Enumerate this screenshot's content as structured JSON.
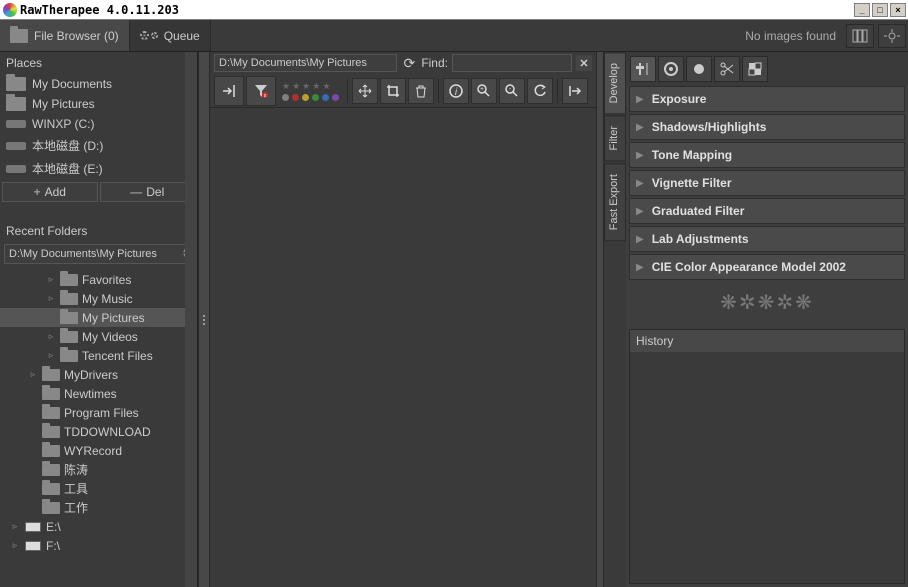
{
  "titlebar": {
    "app_name": "RawTherapee 4.0.11.203"
  },
  "tabs": {
    "file_browser": "File Browser (0)",
    "queue": "Queue"
  },
  "status": {
    "no_images": "No images found"
  },
  "left": {
    "places_label": "Places",
    "places": [
      {
        "kind": "folder",
        "label": "My Documents"
      },
      {
        "kind": "folder",
        "label": "My Pictures"
      },
      {
        "kind": "drive",
        "label": "WINXP (C:)"
      },
      {
        "kind": "drive",
        "label": "本地磁盘 (D:)"
      },
      {
        "kind": "drive",
        "label": "本地磁盘 (E:)"
      }
    ],
    "add_btn": "Add",
    "del_btn": "Del",
    "recent_label": "Recent Folders",
    "recent_value": "D:\\My Documents\\My Pictures",
    "tree": [
      {
        "depth": 2,
        "exp": "▹",
        "kind": "folder",
        "label": "Favorites"
      },
      {
        "depth": 2,
        "exp": "▹",
        "kind": "folder",
        "label": "My Music"
      },
      {
        "depth": 2,
        "exp": "",
        "kind": "folder",
        "label": "My Pictures",
        "selected": true
      },
      {
        "depth": 2,
        "exp": "▹",
        "kind": "folder",
        "label": "My Videos"
      },
      {
        "depth": 2,
        "exp": "▹",
        "kind": "folder",
        "label": "Tencent Files"
      },
      {
        "depth": 1,
        "exp": "▹",
        "kind": "folder",
        "label": "MyDrivers"
      },
      {
        "depth": 1,
        "exp": "",
        "kind": "folder",
        "label": "Newtimes"
      },
      {
        "depth": 1,
        "exp": "",
        "kind": "folder",
        "label": "Program Files"
      },
      {
        "depth": 1,
        "exp": "",
        "kind": "folder",
        "label": "TDDOWNLOAD"
      },
      {
        "depth": 1,
        "exp": "",
        "kind": "folder",
        "label": "WYRecord"
      },
      {
        "depth": 1,
        "exp": "",
        "kind": "folder",
        "label": "陈涛"
      },
      {
        "depth": 1,
        "exp": "",
        "kind": "folder",
        "label": "工具"
      },
      {
        "depth": 1,
        "exp": "",
        "kind": "folder",
        "label": "工作"
      },
      {
        "depth": 0,
        "exp": "▹",
        "kind": "drive",
        "label": "E:\\"
      },
      {
        "depth": 0,
        "exp": "▹",
        "kind": "drive",
        "label": "F:\\"
      }
    ]
  },
  "center": {
    "path": "D:\\My Documents\\My Pictures",
    "find_label": "Find:",
    "color_dots": [
      "#808080",
      "#b03030",
      "#b8a030",
      "#3a8a3a",
      "#3a6ab0",
      "#7a4aa8"
    ]
  },
  "side_tabs": {
    "develop": "Develop",
    "filter": "Filter",
    "export": "Fast Export"
  },
  "right": {
    "sections": [
      "Exposure",
      "Shadows/Highlights",
      "Tone Mapping",
      "Vignette Filter",
      "Graduated Filter",
      "Lab Adjustments",
      "CIE Color Appearance Model 2002"
    ],
    "history_label": "History"
  }
}
